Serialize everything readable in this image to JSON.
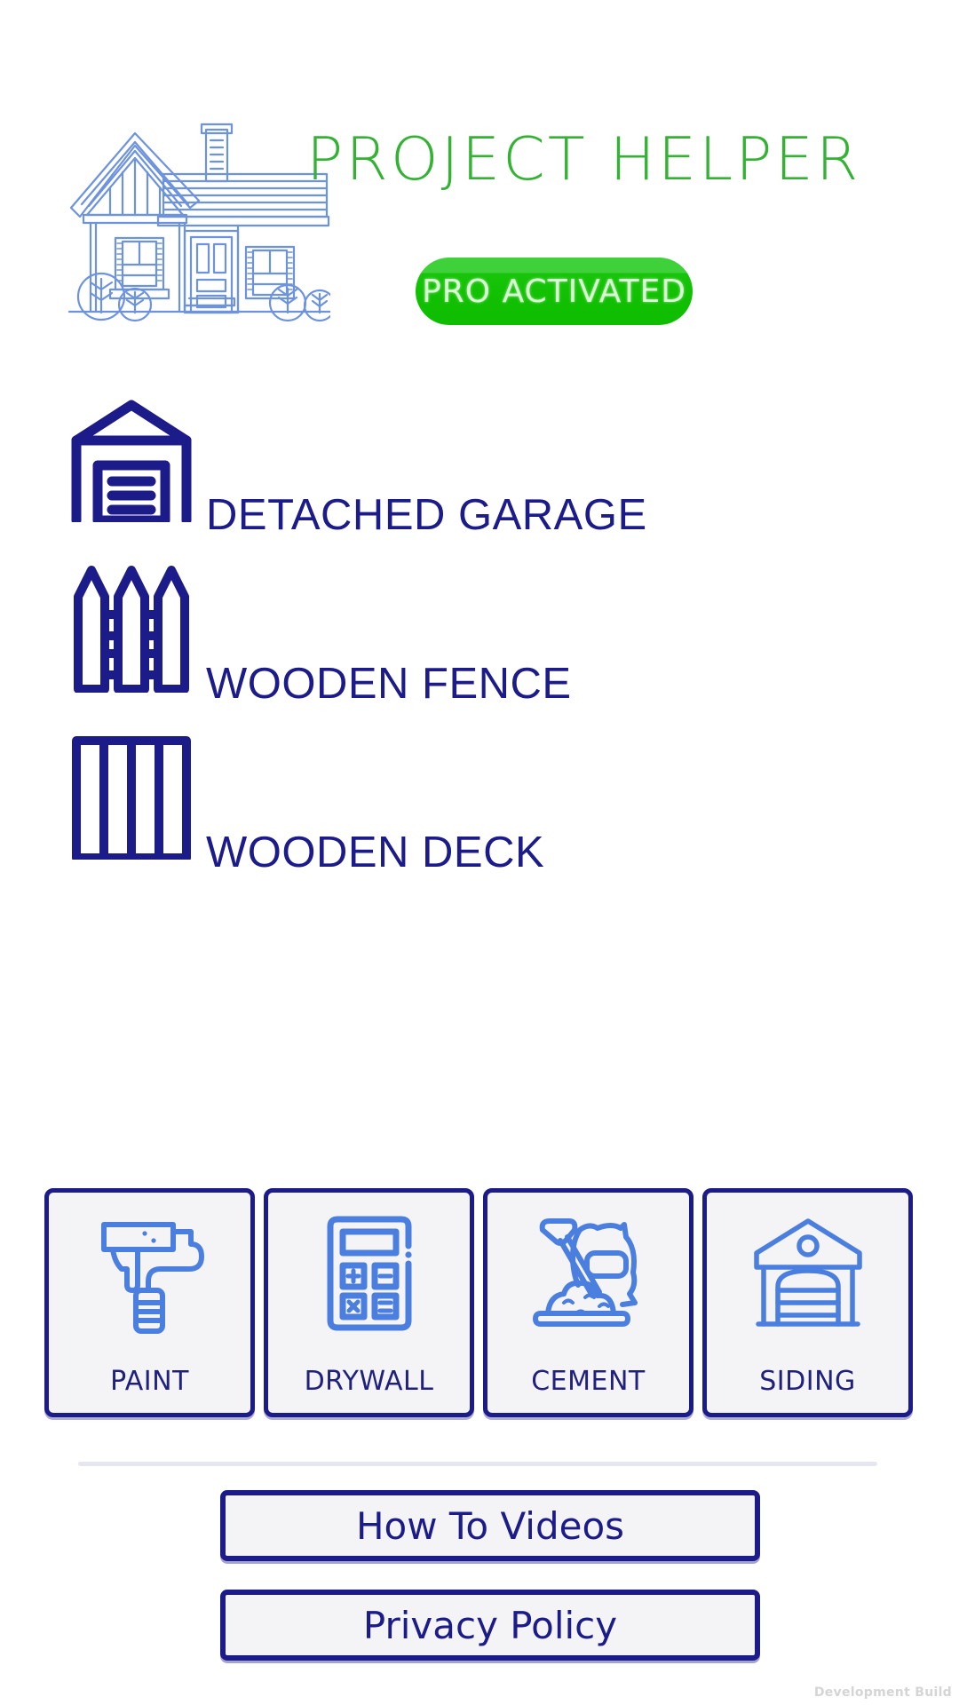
{
  "app": {
    "title": "PROJECT HELPER",
    "title_color": "#34b233",
    "accent_color": "#1c1b8a",
    "badge": {
      "label": "PRO ACTIVATED",
      "color": "#13c206",
      "text_color": "#d9ffd4"
    },
    "logo_icon": "house-illustration-icon"
  },
  "projects": [
    {
      "label": "DETACHED GARAGE",
      "icon": "garage-icon"
    },
    {
      "label": "WOODEN FENCE",
      "icon": "fence-icon"
    },
    {
      "label": "WOODEN DECK",
      "icon": "deck-icon"
    }
  ],
  "calculators": [
    {
      "label": "PAINT",
      "icon": "paint-roller-icon"
    },
    {
      "label": "DRYWALL",
      "icon": "calculator-icon"
    },
    {
      "label": "CEMENT",
      "icon": "cement-bag-shovel-icon"
    },
    {
      "label": "SIDING",
      "icon": "garage-building-icon"
    }
  ],
  "footer": {
    "how_to_videos": "How To Videos",
    "privacy_policy": "Privacy Policy"
  },
  "watermark": "Development Build"
}
